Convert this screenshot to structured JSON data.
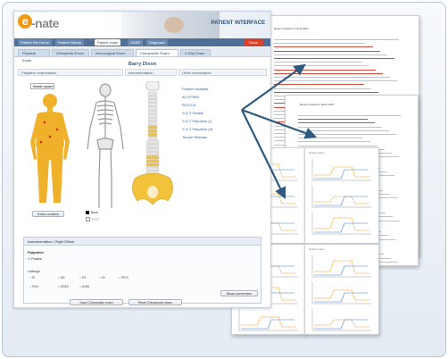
{
  "app": {
    "logo_letter": "e",
    "logo_text": "-nate",
    "page_title": "PATIENT INTERFACE",
    "top_tabs": [
      "Patient File Home",
      "Patient History",
      "Patient exam",
      "SOAP",
      "Diagnosis"
    ],
    "close_label": "Close",
    "sub_tabs": [
      "Physical Exam",
      "Orthopedic Exam",
      "Neurological Exam",
      "Chiropractic Exam",
      "X-Ray Exam"
    ],
    "patient_name": "Barry Dixon",
    "columns": {
      "palpation": "Palpation examination",
      "instrumentation": "Instrumentation",
      "other": "Other examination"
    },
    "select_value": "Muscle spasm",
    "other_links": [
      "Posture analysis",
      "AO FORM",
      "RC/CCA",
      "S.O.T Details",
      "S.O.T Palpation (I)",
      "S.O.T Palpation (II)",
      "Torque Release"
    ],
    "reset_condition": "Reset condition",
    "legend": [
      "Back",
      "Front"
    ],
    "panel": {
      "header": "Instrumentation / Right Ellium",
      "palpation_label": "Palpation",
      "palpation_check": "Fixation",
      "listings_label": "Listings",
      "row1": [
        "EI",
        "AS",
        "EX",
        "IN",
        "PIEX"
      ],
      "row2": [
        "PIIN",
        "ASEX",
        "ASIN"
      ],
      "reset_btn": "Reset current item"
    },
    "save_btn": "Save Chiropractic exam",
    "reset_btn": "Reset Chiropractic exam"
  },
  "docs": {
    "page1_title": "Report created in Excel 2007",
    "page2_title": "Report created in Word 2007",
    "graph_title": "Graph report"
  },
  "colors": {
    "accent": "#ee9a12",
    "nav": "#4d6f98",
    "highlight": "#f2c33a",
    "graph_orange": "#f0a030",
    "graph_blue": "#3f7fd0"
  }
}
